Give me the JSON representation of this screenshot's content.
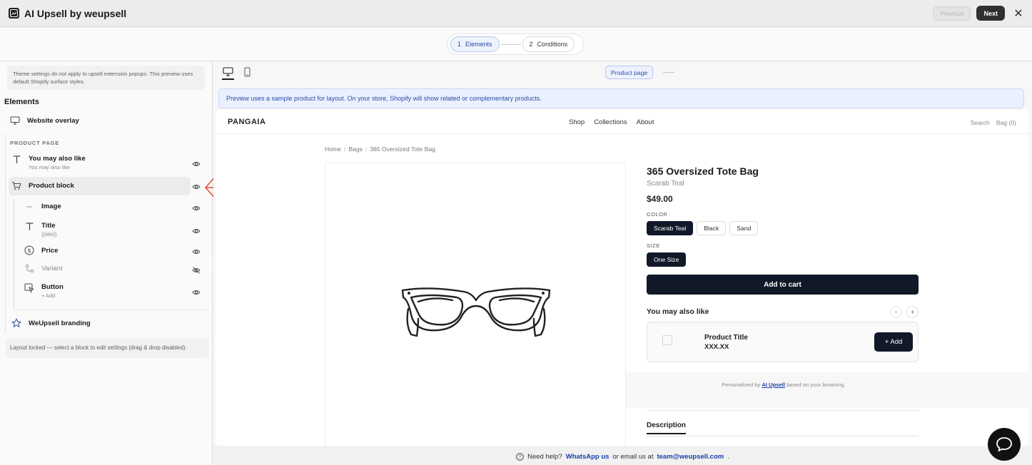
{
  "app": {
    "title": "AI Upsell by weupsell",
    "prev_label": "Previous",
    "next_label": "Next",
    "close_glyph": "✕"
  },
  "stepper": {
    "steps": [
      {
        "num": "1",
        "label": "Elements"
      },
      {
        "num": "2",
        "label": "Conditions"
      }
    ]
  },
  "sidebar": {
    "notice": "Theme settings do not apply to upsell extension popups. This preview uses default Shopify surface styles.",
    "heading": "Elements",
    "overlay_label": "Website overlay",
    "section_label": "PRODUCT PAGE",
    "items": [
      {
        "label": "You may also like",
        "sub": "You may also like"
      },
      {
        "label": "Product block",
        "sub": ""
      },
      {
        "label": "Image",
        "sub": ""
      },
      {
        "label": "Title",
        "sub": "{{title}}"
      },
      {
        "label": "Price",
        "sub": ""
      },
      {
        "label": "Variant",
        "sub": ""
      },
      {
        "label": "Button",
        "sub": "+ Add"
      }
    ],
    "branding_label": "WeUpsell branding",
    "lock_note": "Layout locked — select a block to edit settings (drag & drop disabled)."
  },
  "preview": {
    "page_pill": "Product page",
    "banner": "Preview uses a sample product for layout. On your store, Shopify will show related or complementary products.",
    "store": {
      "brand": "PANGAIA",
      "nav": [
        "Shop",
        "Collections",
        "About"
      ],
      "nav_right": [
        "Search",
        "Bag (0)"
      ],
      "breadcrumb": [
        "Home",
        "Bags",
        "365 Oversized Tote Bag"
      ]
    },
    "product": {
      "title": "365 Oversized Tote Bag",
      "variant": "Scarab Teal",
      "price": "$49.00",
      "color_label": "COLOR",
      "colors": [
        "Scarab Teal",
        "Black",
        "Sand"
      ],
      "size_label": "SIZE",
      "sizes": [
        "One Size"
      ],
      "add_to_cart": "Add to cart"
    },
    "upsell": {
      "title": "You may also like",
      "card_title": "Product Title",
      "card_price": "XXX.XX",
      "card_add": "+ Add",
      "personal_before": "Personalized by",
      "personal_link": "AI Upsell",
      "personal_after": "based on your browsing"
    },
    "description_tab": "Description"
  },
  "footer": {
    "help": "Need help?",
    "whatsapp": "WhatsApp us",
    "or_email": "or email us at",
    "email": "team@weupsell.com",
    "period": "."
  },
  "colors": {
    "accent": "#2c4ba8",
    "primary_dark": "#111827",
    "annotation_arrow": "#e8452c"
  }
}
